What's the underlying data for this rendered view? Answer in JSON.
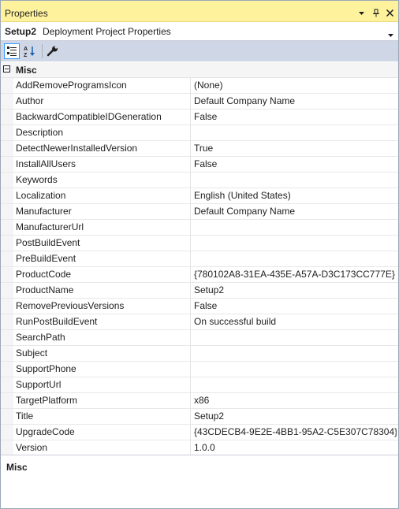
{
  "window": {
    "title": "Properties",
    "pin_icon": "dropdown-arrow-icon",
    "autohide_icon": "pin-icon",
    "close_icon": "close-icon"
  },
  "selector": {
    "object_name": "Setup2",
    "object_type": "Deployment Project Properties"
  },
  "toolbar": {
    "categorized_icon": "categorized-icon",
    "alphabetical_icon": "alphabetical-icon",
    "property_pages_icon": "wrench-icon"
  },
  "grid": {
    "category": "Misc",
    "properties": [
      {
        "name": "AddRemoveProgramsIcon",
        "value": "(None)"
      },
      {
        "name": "Author",
        "value": "Default Company Name"
      },
      {
        "name": "BackwardCompatibleIDGeneration",
        "value": "False"
      },
      {
        "name": "Description",
        "value": ""
      },
      {
        "name": "DetectNewerInstalledVersion",
        "value": "True"
      },
      {
        "name": "InstallAllUsers",
        "value": "False"
      },
      {
        "name": "Keywords",
        "value": ""
      },
      {
        "name": "Localization",
        "value": "English (United States)"
      },
      {
        "name": "Manufacturer",
        "value": "Default Company Name"
      },
      {
        "name": "ManufacturerUrl",
        "value": ""
      },
      {
        "name": "PostBuildEvent",
        "value": ""
      },
      {
        "name": "PreBuildEvent",
        "value": ""
      },
      {
        "name": "ProductCode",
        "value": "{780102A8-31EA-435E-A57A-D3C173CC777E}"
      },
      {
        "name": "ProductName",
        "value": "Setup2"
      },
      {
        "name": "RemovePreviousVersions",
        "value": "False"
      },
      {
        "name": "RunPostBuildEvent",
        "value": "On successful build"
      },
      {
        "name": "SearchPath",
        "value": ""
      },
      {
        "name": "Subject",
        "value": ""
      },
      {
        "name": "SupportPhone",
        "value": ""
      },
      {
        "name": "SupportUrl",
        "value": ""
      },
      {
        "name": "TargetPlatform",
        "value": "x86"
      },
      {
        "name": "Title",
        "value": "Setup2"
      },
      {
        "name": "UpgradeCode",
        "value": "{43CDECB4-9E2E-4BB1-95A2-C5E307C78304}"
      },
      {
        "name": "Version",
        "value": "1.0.0"
      }
    ]
  },
  "description": {
    "title": "Misc"
  },
  "colors": {
    "titlebar": "#fff29d",
    "toolbar": "#cfd6e5",
    "selected_border": "#3399ff"
  }
}
